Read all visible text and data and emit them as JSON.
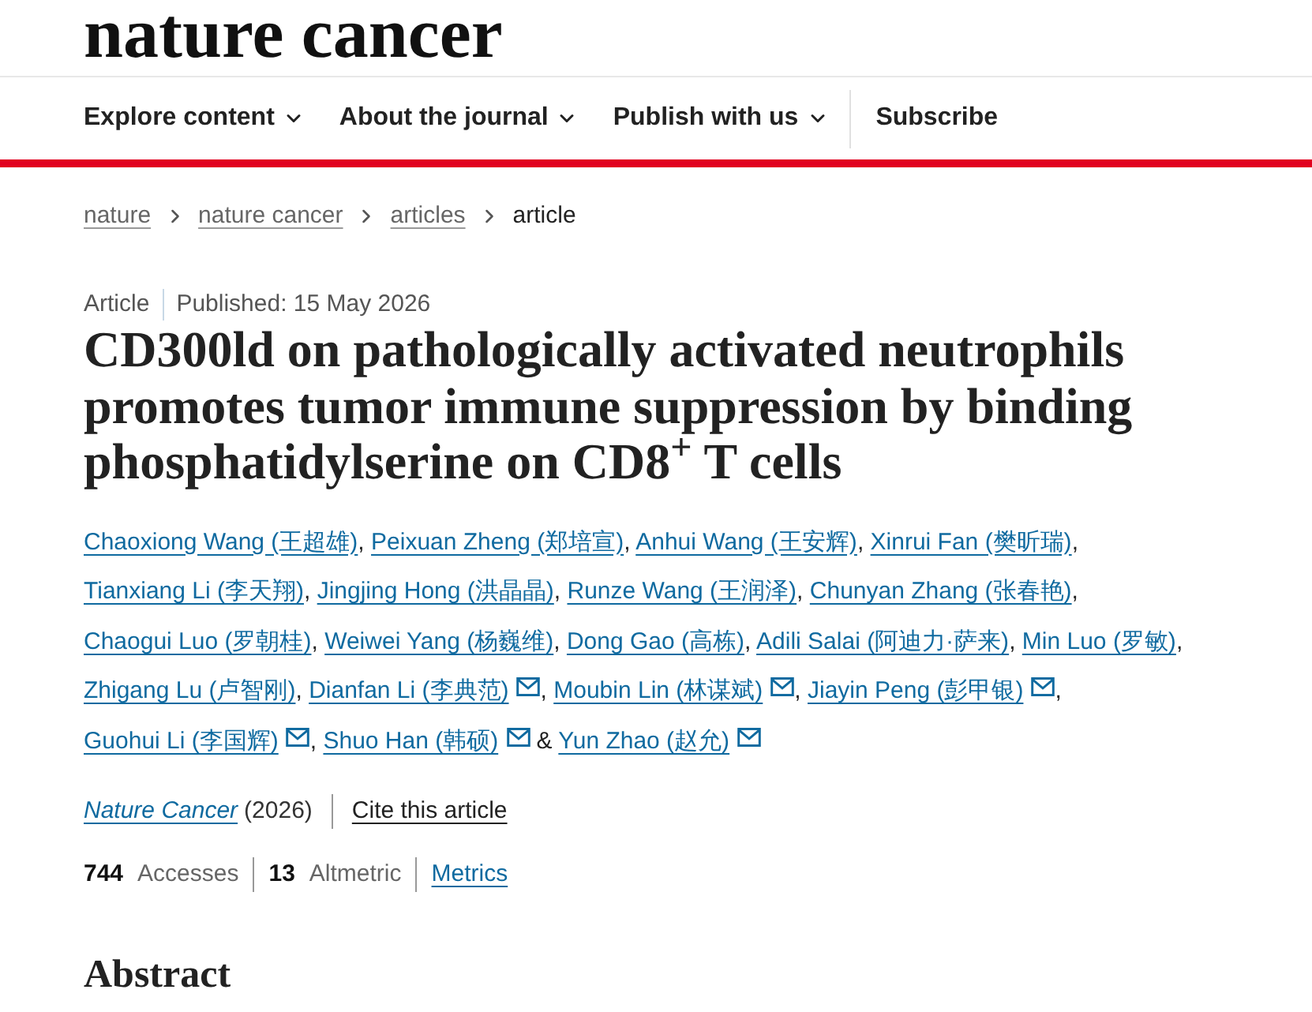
{
  "header": {
    "logo": "nature cancer"
  },
  "nav": {
    "items": [
      {
        "label": "Explore content",
        "dropdown": true
      },
      {
        "label": "About the journal",
        "dropdown": true
      },
      {
        "label": "Publish with us",
        "dropdown": true
      },
      {
        "label": "Subscribe",
        "dropdown": false
      }
    ]
  },
  "breadcrumb": [
    {
      "label": "nature",
      "current": false
    },
    {
      "label": "nature cancer",
      "current": false
    },
    {
      "label": "articles",
      "current": false
    },
    {
      "label": "article",
      "current": true
    }
  ],
  "article": {
    "type": "Article",
    "published": "Published: 15 May 2026",
    "title": "CD300ld on pathologically activated neutrophils promotes tumor immune suppression by binding phosphatidylserine on CD8$^{+}$ T cells",
    "authors": [
      {
        "name": "Chaoxiong Wang (王超雄)",
        "corresponding": false,
        "separator": ", "
      },
      {
        "name": "Peixuan Zheng (郑培宣)",
        "corresponding": false,
        "separator": ", "
      },
      {
        "name": "Anhui Wang (王安辉)",
        "corresponding": false,
        "separator": ", "
      },
      {
        "name": "Xinrui Fan (樊昕瑞)",
        "corresponding": false,
        "separator": ", "
      },
      {
        "name": "Tianxiang Li (李天翔)",
        "corresponding": false,
        "separator": ", "
      },
      {
        "name": "Jingjing Hong (洪晶晶)",
        "corresponding": false,
        "separator": ", "
      },
      {
        "name": "Runze Wang (王润泽)",
        "corresponding": false,
        "separator": ", "
      },
      {
        "name": "Chunyan Zhang (张春艳)",
        "corresponding": false,
        "separator": ", "
      },
      {
        "name": "Chaogui Luo (罗朝桂)",
        "corresponding": false,
        "separator": ", "
      },
      {
        "name": "Weiwei Yang (杨巍维)",
        "corresponding": false,
        "separator": ", "
      },
      {
        "name": "Dong Gao (高栋)",
        "corresponding": false,
        "separator": ", "
      },
      {
        "name": "Adili Salai (阿迪力·萨来)",
        "corresponding": false,
        "separator": ", "
      },
      {
        "name": "Min Luo (罗敏)",
        "corresponding": false,
        "separator": ", "
      },
      {
        "name": "Zhigang Lu (卢智刚)",
        "corresponding": false,
        "separator": ", "
      },
      {
        "name": "Dianfan Li (李典范)",
        "corresponding": true,
        "separator": ", "
      },
      {
        "name": "Moubin Lin (林谋斌)",
        "corresponding": true,
        "separator": ", "
      },
      {
        "name": "Jiayin Peng (彭甲银)",
        "corresponding": true,
        "separator": ", "
      },
      {
        "name": "Guohui Li (李国辉)",
        "corresponding": true,
        "separator": ", "
      },
      {
        "name": "Shuo Han (韩硕)",
        "corresponding": true,
        "separator": " & "
      },
      {
        "name": "Yun Zhao (赵允)",
        "corresponding": true
      }
    ],
    "journal": "Nature Cancer",
    "year": "(2026)",
    "cite": "Cite this article",
    "metrics": [
      {
        "count": "744",
        "measure": "Accesses"
      },
      {
        "count": "13",
        "measure": "Altmetric"
      }
    ],
    "metrics_link": "Metrics"
  },
  "section": {
    "heading": "Abstract"
  }
}
